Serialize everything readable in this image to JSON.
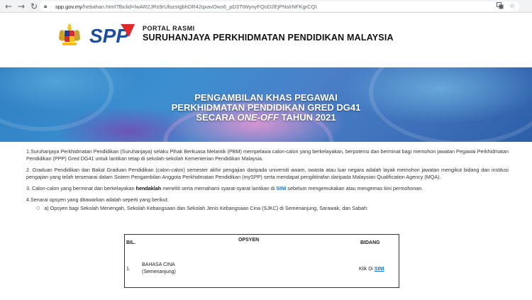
{
  "browser": {
    "url_domain": "spp.gov.my",
    "url_path": "/hebahan.html?fbclid=IwAR2JRs9rUfozstgbhDR42qxavOws6_pD3TtWynyFQoD2EjPNslrNFKgrCQI",
    "icons": [
      "back-icon",
      "forward-icon",
      "reload-icon",
      "lock-icon",
      "translate-icon",
      "star-icon"
    ]
  },
  "header": {
    "portal_label": "PORTAL RASMI",
    "portal_name": "SURUHANJAYA PERKHIDMATAN PENDIDIKAN MALAYSIA",
    "logo_text": "SPP"
  },
  "banner": {
    "line1": "PENGAMBILAN KHAS PEGAWAI",
    "line2": "PERKHIDMATAN PENDIDIKAN GRED DG41",
    "line3_prefix": "SECARA ",
    "line3_emph": "ONE-OFF",
    "line3_suffix": " TAHUN 2021"
  },
  "content": {
    "p1": "1.Suruhanjaya Perkhidmatan Pendidikan (Suruhanjaya) selaku Pihak Berkuasa Melantik (PBM) mempelawa calon-calon yang berkelayakan, berpotensi dan berminat bagi memohon jawatan Pegawai Perkhidmatan Pendidikan (PPP) Gred DG41 untuk lantikan tetap di sekolah-sekolah Kementerian Pendidikan Malaysia.",
    "p2": "2. Graduan Pendidikan dan Bakal Graduan Pendidikan (calon-calon) semester akhir pengajian daripada universiti awam, swasta atau luar negara adalah layak memohon jawatan mengikut bidang dan institusi pengajian yang telah tersenarai dalam Sistem Pengambilan Anggota Perkhidmatan Pendidikan (mySPP) serta mendapat pengiktirafan daripada Malaysian Qualification Agency (MQA).",
    "p3_a": "3. Calon-calon yang berminat dan berkelayakan ",
    "p3_bold": "hendaklah",
    "p3_b": " meneliti serta memahami syarat-syarat lantikan di ",
    "p3_link": "SINI",
    "p3_c": " sebelum mengemukakan atau mengemas kini permohonan.",
    "p4": "4.Senarai opsyen yang ditawarkan adalah seperti yang berikut:",
    "sub_a": "a) Opsyen bagi Sekolah Menengah, Sekolah Kebangsaan dan Sekolah Jenis Kebangsaan Cina (SJKC) di Semenanjung, Sarawak, dan Sabah:"
  },
  "table": {
    "headers": {
      "num": "BIL.",
      "opsyen": "OPSYEN",
      "bidang": "BIDANG"
    },
    "rows": [
      {
        "num": "1.",
        "name_line1": "BAHASA CINA",
        "name_line2": "(Semenanjung)",
        "bidang_prefix": "Klik Di ",
        "bidang_link": "SINI"
      }
    ]
  },
  "colors": {
    "link": "#1a73c8",
    "banner_base": "#3b8fd0",
    "spp_blue": "#1d4fa0",
    "spp_red": "#e02a2a"
  }
}
